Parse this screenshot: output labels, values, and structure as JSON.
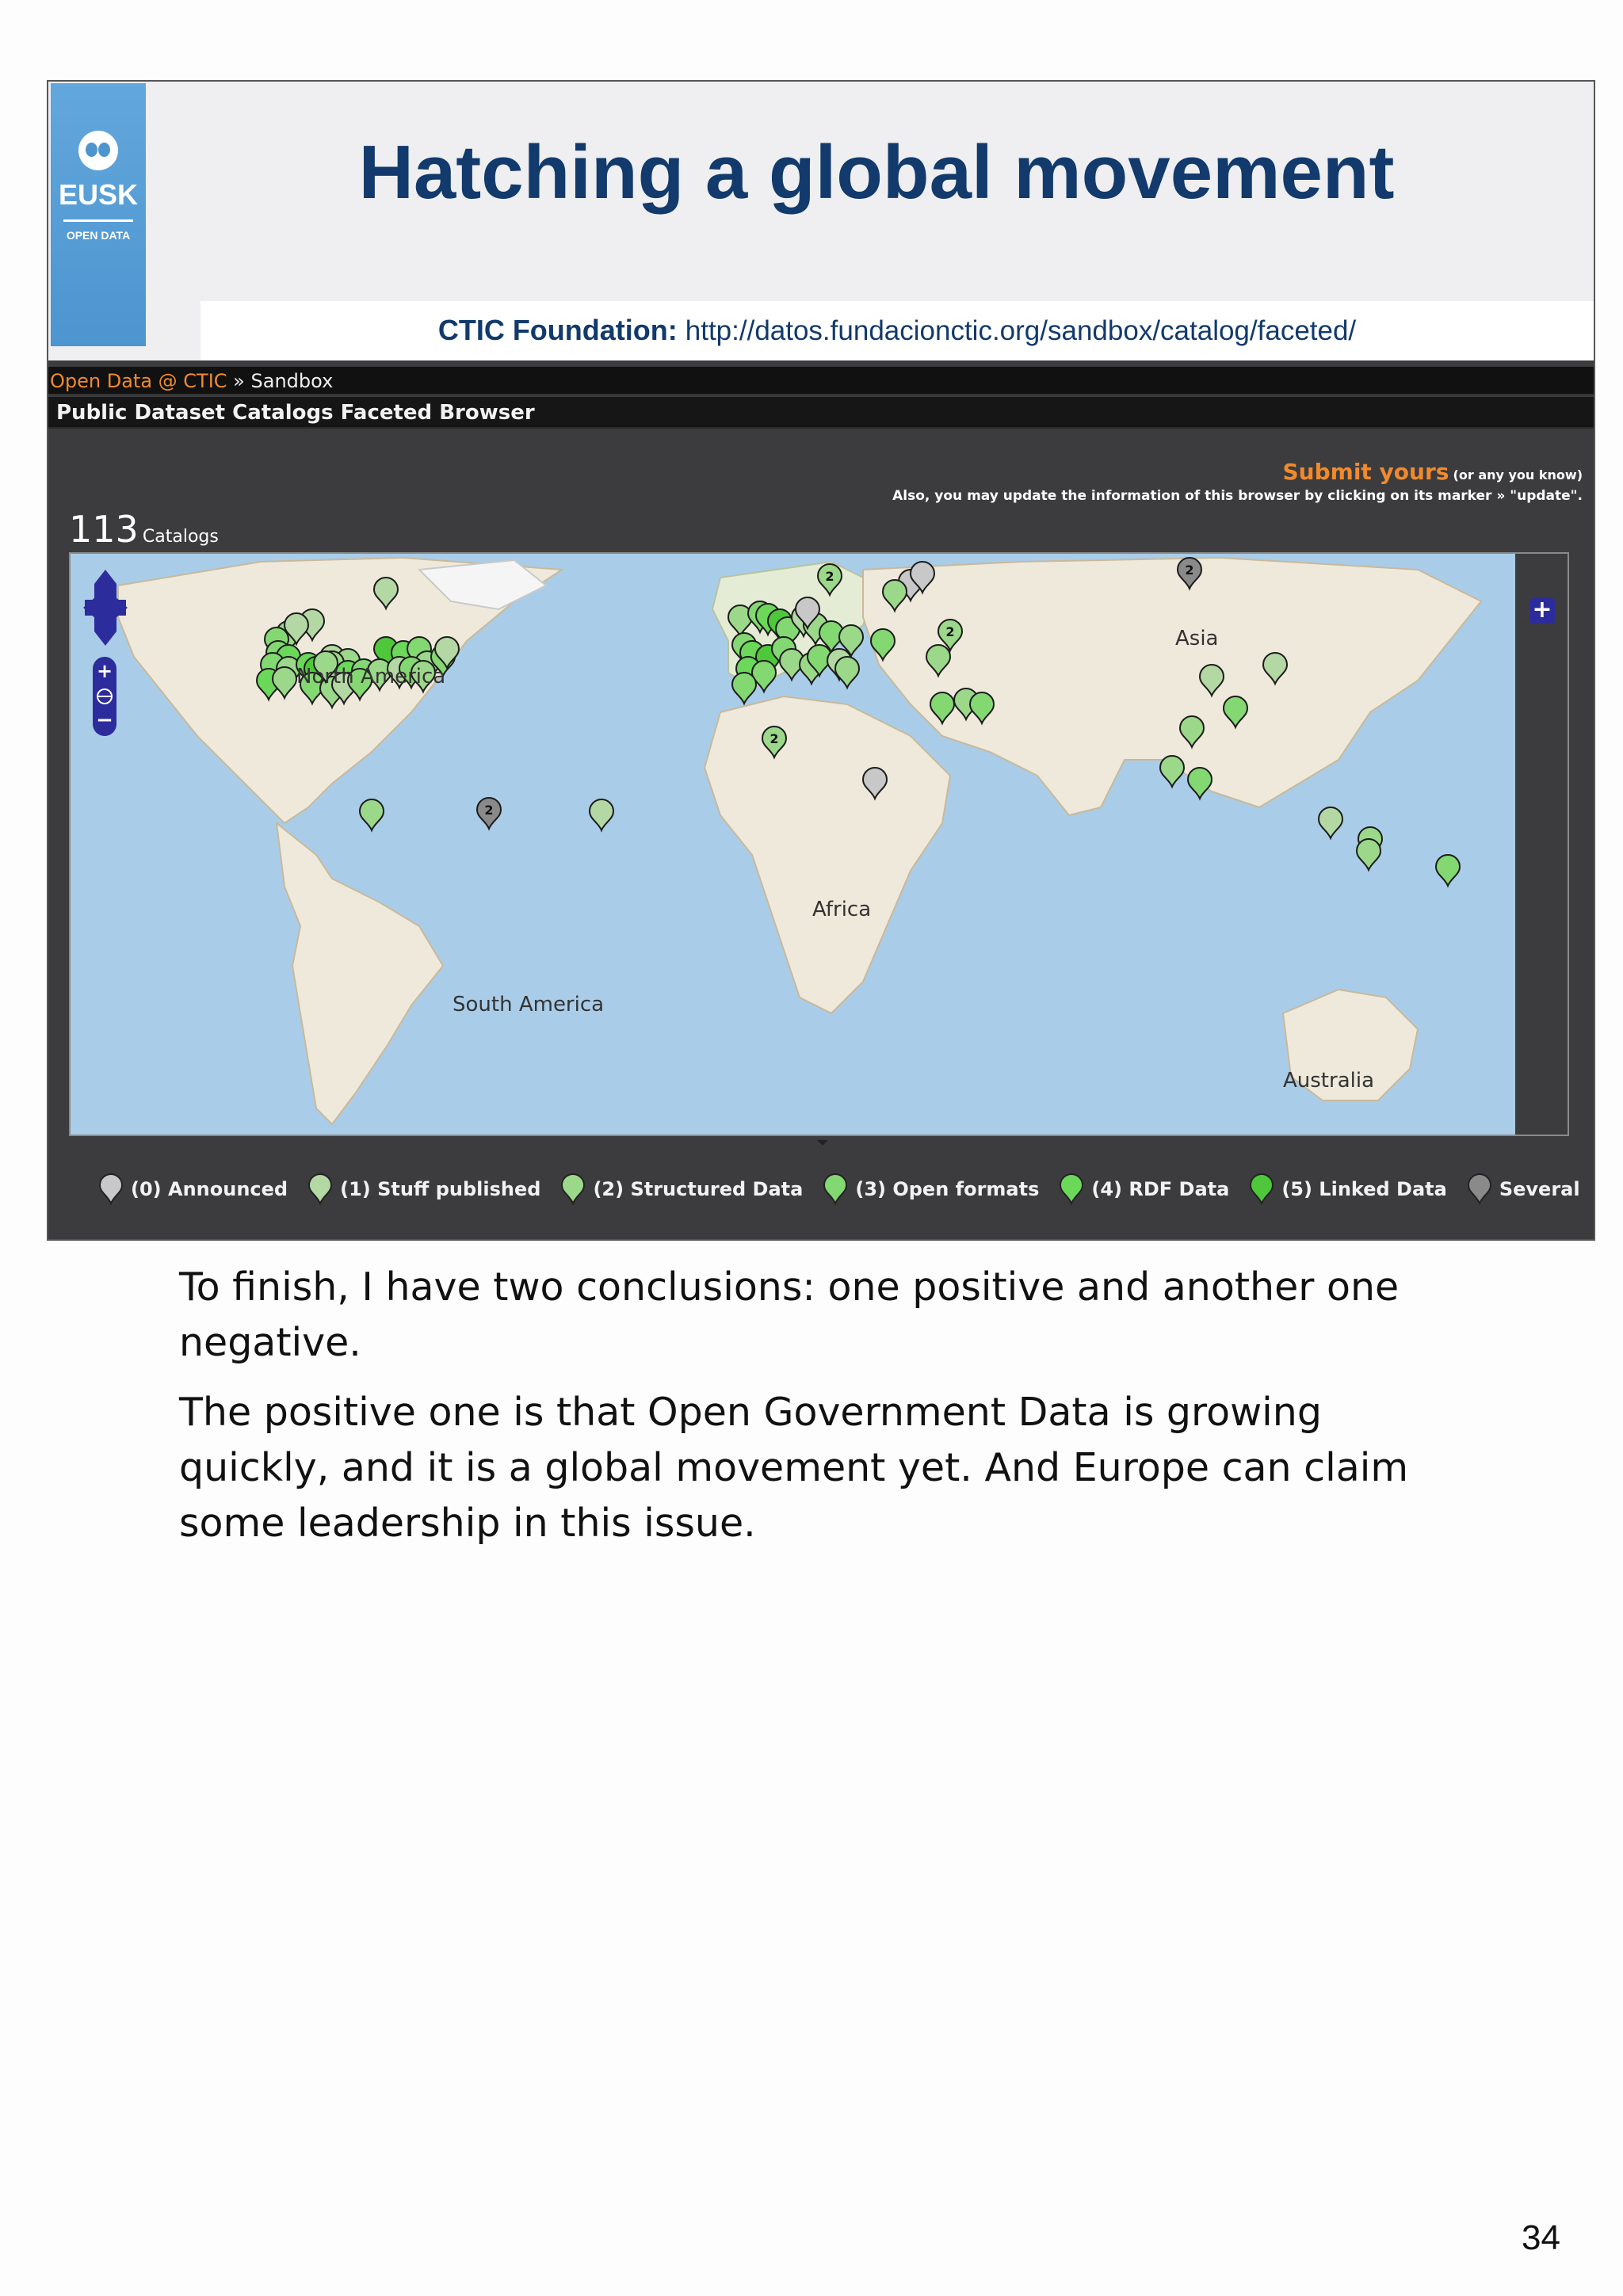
{
  "slide": {
    "logo_text": "EUSK",
    "logo_sub": "OPEN DATA",
    "title": "Hatching a global movement",
    "ctic_label": "CTIC Foundation:",
    "ctic_url": "http://datos.fundacionctic.org/sandbox/catalog/faceted/"
  },
  "browser": {
    "breadcrumb_link": "Open Data @ CTIC",
    "breadcrumb_sep": " » ",
    "breadcrumb_current": "Sandbox",
    "app_title": "Public Dataset Catalogs Faceted Browser",
    "submit_label": "Submit yours",
    "submit_note": "(or any you know)",
    "update_note": "Also, you may update the information of this browser by clicking on its marker » \"update\".",
    "catalog_count": "113",
    "catalog_label": "Catalogs",
    "continents": {
      "north_america": "North America",
      "asia": "Asia",
      "africa": "Africa",
      "south_america": "South America",
      "australia": "Australia"
    },
    "expand_symbol": "+",
    "legend": [
      {
        "label": "(0) Announced",
        "color": "#c8c8c8"
      },
      {
        "label": "(1) Stuff published",
        "color": "#b4d8a4"
      },
      {
        "label": "(2) Structured Data",
        "color": "#9cd88a"
      },
      {
        "label": "(3) Open formats",
        "color": "#84d872"
      },
      {
        "label": "(4) RDF Data",
        "color": "#6cd85a"
      },
      {
        "label": "(5) Linked Data",
        "color": "#4ec83a"
      },
      {
        "label": "Several",
        "color": "#8a8a8a"
      }
    ],
    "cluster_labels": [
      "2",
      "2",
      "2",
      "2",
      "2"
    ]
  },
  "notes": {
    "p1": "To finish, I have two conclusions: one positive and another one negative.",
    "p2": "The positive one is that Open Government Data is growing quickly, and it is a global movement yet. And Europe can claim some leadership in this issue."
  },
  "page_number": "34"
}
